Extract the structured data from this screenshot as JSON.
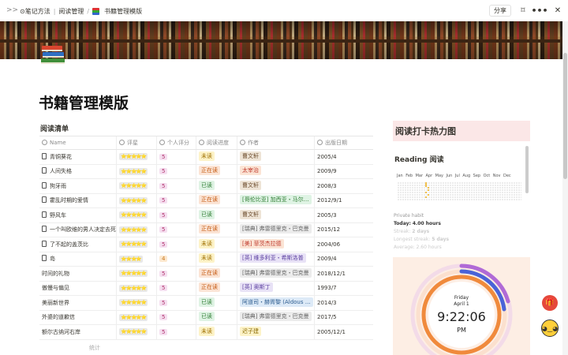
{
  "breadcrumb": {
    "items": [
      "⊙笔记方法",
      "阅读管理"
    ],
    "current": "书籍管理模版"
  },
  "toolbar": {
    "share": "分享"
  },
  "page": {
    "title": "书籍管理模版",
    "db_title": "阅读清单",
    "stats": "统计"
  },
  "table": {
    "columns": [
      "Name",
      "评星",
      "个人评分",
      "阅读进度",
      "作者",
      "出版日期"
    ],
    "rows": [
      {
        "name": "青铜葵花",
        "stars": "⭐⭐⭐⭐⭐",
        "score": "5",
        "status": "未读",
        "status_class": "s-no",
        "author": "曹文轩",
        "author_class": "a-brown",
        "date": "2005/4",
        "doc": true
      },
      {
        "name": "人间失格",
        "stars": "⭐⭐⭐⭐⭐",
        "score": "5",
        "status": "正在读",
        "status_class": "s-ing",
        "author": "太宰治",
        "author_class": "a-red",
        "date": "2009/9",
        "doc": true
      },
      {
        "name": "狗牙雨",
        "stars": "⭐⭐⭐⭐⭐",
        "score": "5",
        "status": "已读",
        "status_class": "s-done",
        "author": "曹文轩",
        "author_class": "a-brown",
        "date": "2008/3",
        "doc": true
      },
      {
        "name": "霍乱时期的爱情",
        "stars": "⭐⭐⭐⭐⭐",
        "score": "5",
        "status": "正在读",
        "status_class": "s-ing",
        "author": "[哥伦比亚] 加西亚・马尔…",
        "author_class": "a-green",
        "date": "2012/9/1",
        "doc": true
      },
      {
        "name": "野风车",
        "stars": "⭐⭐⭐⭐⭐",
        "score": "5",
        "status": "已读",
        "status_class": "s-done",
        "author": "曹文轩",
        "author_class": "a-brown",
        "date": "2005/3",
        "doc": true
      },
      {
        "name": "一个叫欧维的男人决定去死",
        "stars": "⭐⭐⭐⭐⭐",
        "score": "5",
        "status": "正在读",
        "status_class": "s-ing",
        "author": "[瑞典] 弗雷德里克・巴克曼",
        "author_class": "a-gray",
        "date": "2015/12",
        "doc": true
      },
      {
        "name": "了不起的盖茨比",
        "stars": "⭐⭐⭐⭐⭐",
        "score": "5",
        "status": "未读",
        "status_class": "s-no",
        "author": "[美] 菲茨杰拉德",
        "author_class": "a-red",
        "date": "2004/06",
        "doc": true
      },
      {
        "name": "岛",
        "stars": "⭐⭐⭐⭐",
        "score": "4",
        "status": "未读",
        "status_class": "s-no",
        "author": "[英] 维多利亚・希斯洛普",
        "author_class": "a-purple",
        "date": "2009/4",
        "doc": true
      },
      {
        "name": "时间的礼物",
        "stars": "⭐⭐⭐⭐⭐",
        "score": "5",
        "status": "正在读",
        "status_class": "s-ing",
        "author": "[瑞典] 弗雷德里克・巴克曼",
        "author_class": "a-gray",
        "date": "2018/12/1",
        "doc": false
      },
      {
        "name": "傲慢与偏见",
        "stars": "⭐⭐⭐⭐⭐",
        "score": "5",
        "status": "正在读",
        "status_class": "s-ing",
        "author": "[英] 奥斯丁",
        "author_class": "a-purple",
        "date": "1993/7",
        "doc": false
      },
      {
        "name": "美丽新世界",
        "stars": "⭐⭐⭐⭐⭐",
        "score": "5",
        "status": "已读",
        "status_class": "s-done",
        "author": "阿道司・赫胥黎 (Aldous …",
        "author_class": "a-blue",
        "date": "2014/3",
        "doc": false
      },
      {
        "name": "外婆的道歉信",
        "stars": "⭐⭐⭐⭐⭐",
        "score": "5",
        "status": "已读",
        "status_class": "s-done",
        "author": "[瑞典] 弗雷德里克・巴克曼",
        "author_class": "a-gray",
        "date": "2017/5",
        "doc": false
      },
      {
        "name": "额尔古纳河右岸",
        "stars": "⭐⭐⭐⭐⭐",
        "score": "5",
        "status": "未读",
        "status_class": "s-no",
        "author": "迟子建",
        "author_class": "a-yellow",
        "date": "2005/12/1",
        "doc": false
      }
    ]
  },
  "heatmap": {
    "title": "阅读打卡热力图",
    "heading": "Reading 阅读",
    "months": [
      "Jan",
      "Feb",
      "Mar",
      "Apr",
      "May",
      "Jun",
      "Jul",
      "Aug",
      "Sep",
      "Oct",
      "Nov",
      "Dec"
    ],
    "habit": "Private habit",
    "today_label": "Today:",
    "today_value": "4.00 hours",
    "streak_label": "Streak:",
    "streak_value": "2 days",
    "longest_label": "Longest streak:",
    "longest_value": "5 days",
    "average": "Average: 2.60 hours"
  },
  "clock": {
    "weekday": "Friday",
    "date": "April 1",
    "time": "9:22:06",
    "ampm": "PM"
  }
}
